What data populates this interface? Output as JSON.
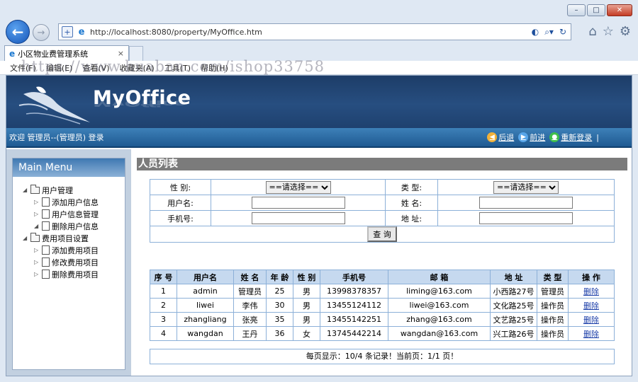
{
  "window": {
    "controls": {
      "minimize": "–",
      "maximize": "□",
      "close": "✕"
    }
  },
  "browser": {
    "back_glyph": "←",
    "forward_glyph": "→",
    "address_url": "http://localhost:8080/property/MyOffice.htm",
    "tab_title": "小区物业费管理系统",
    "tab_close": "×",
    "menu": [
      "文件(F)",
      "编辑(E)",
      "查看(V)",
      "收藏夹(A)",
      "工具(T)",
      "帮助(H)"
    ]
  },
  "watermark": "https://www.huaban.com/ishop33758",
  "header": {
    "logo_text": "MyOffice",
    "welcome_text": "欢迎 管理员--(管理员) 登录",
    "nav": {
      "back": "后退",
      "forward": "前进",
      "relogin": "重新登录"
    },
    "divider": "|"
  },
  "sidebar": {
    "title": "Main Menu",
    "groups": [
      {
        "label": "用户管理",
        "items": [
          "添加用户信息",
          "用户信息管理",
          "删除用户信息"
        ]
      },
      {
        "label": "费用项目设置",
        "items": [
          "添加费用项目",
          "修改费用项目",
          "删除费用项目"
        ]
      }
    ]
  },
  "main": {
    "title": "人员列表",
    "query": {
      "gender_label": "性 别:",
      "gender_value": "==请选择==",
      "type_label": "类 型:",
      "type_value": "==请选择==",
      "username_label": "用户名:",
      "name_label": "姓 名:",
      "phone_label": "手机号:",
      "address_label": "地 址:",
      "search_button": "查 询"
    },
    "table": {
      "headers": [
        "序 号",
        "用户名",
        "姓 名",
        "年 龄",
        "性 别",
        "手机号",
        "邮 箱",
        "地 址",
        "类 型",
        "操 作"
      ],
      "rows": [
        {
          "id": "1",
          "username": "admin",
          "name": "管理员",
          "age": "25",
          "gender": "男",
          "phone": "13998378357",
          "email": "liming@163.com",
          "address": "小西路27号",
          "type": "管理员",
          "action": "删除"
        },
        {
          "id": "2",
          "username": "liwei",
          "name": "李伟",
          "age": "30",
          "gender": "男",
          "phone": "13455124112",
          "email": "liwei@163.com",
          "address": "文化路25号",
          "type": "操作员",
          "action": "删除"
        },
        {
          "id": "3",
          "username": "zhangliang",
          "name": "张亮",
          "age": "35",
          "gender": "男",
          "phone": "13455142251",
          "email": "zhang@163.com",
          "address": "文艺路25号",
          "type": "操作员",
          "action": "删除"
        },
        {
          "id": "4",
          "username": "wangdan",
          "name": "王丹",
          "age": "36",
          "gender": "女",
          "phone": "13745442214",
          "email": "wangdan@163.com",
          "address": "兴工路26号",
          "type": "操作员",
          "action": "删除"
        }
      ]
    },
    "pager": "每页显示：10/4 条记录！当前页：1/1 页！"
  }
}
